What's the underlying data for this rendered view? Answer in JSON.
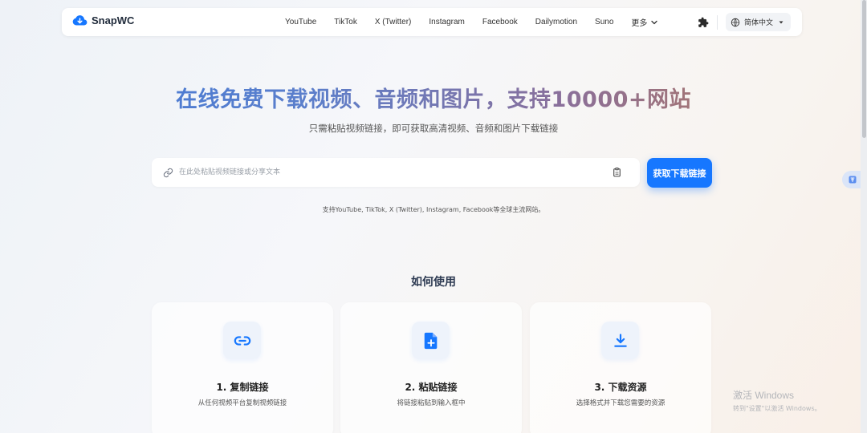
{
  "brand": {
    "name": "SnapWC",
    "accent": "#1677ff"
  },
  "nav": {
    "links": [
      "YouTube",
      "TikTok",
      "X (Twitter)",
      "Instagram",
      "Facebook",
      "Dailymotion",
      "Suno"
    ],
    "more_label": "更多",
    "lang_label": "简体中文"
  },
  "hero": {
    "title": "在线免费下载视频、音频和图片，支持10000+网站",
    "subtitle": "只需粘贴视频链接，即可获取高清视频、音频和图片下载链接"
  },
  "search": {
    "placeholder": "在此处粘贴视频链接或分享文本",
    "value": "",
    "button_label": "获取下载链接"
  },
  "support_text": "支持YouTube, TikTok, X (Twitter), Instagram, Facebook等全球主流网站。",
  "how_to": {
    "title": "如何使用",
    "steps": [
      {
        "title": "1. 复制链接",
        "desc": "从任何视频平台复制视频链接",
        "icon": "link-icon"
      },
      {
        "title": "2. 粘贴链接",
        "desc": "将链接粘贴到输入框中",
        "icon": "file-plus-icon"
      },
      {
        "title": "3. 下载资源",
        "desc": "选择格式并下载您需要的资源",
        "icon": "download-icon"
      }
    ]
  },
  "watermark": {
    "title": "激活 Windows",
    "subtitle": "转到\"设置\"以激活 Windows。"
  }
}
